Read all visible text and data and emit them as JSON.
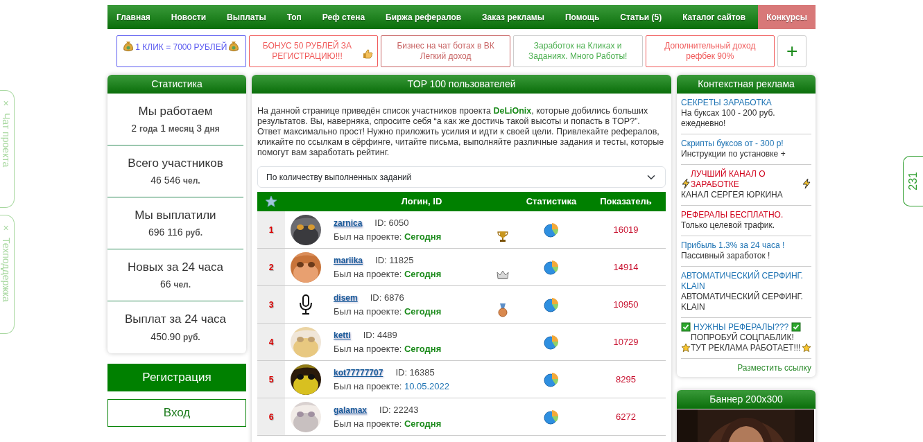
{
  "side_tabs": [
    {
      "close": "×",
      "label": "Чат проекта"
    },
    {
      "close": "×",
      "label": "Техподдержка"
    }
  ],
  "counter_tab": "231",
  "nav": [
    {
      "label": "Главная",
      "selected": false
    },
    {
      "label": "Новости",
      "selected": false
    },
    {
      "label": "Выплаты",
      "selected": false
    },
    {
      "label": "Топ",
      "selected": false
    },
    {
      "label": "Реф стена",
      "selected": false
    },
    {
      "label": "Биржа рефералов",
      "selected": false
    },
    {
      "label": "Заказ рекламы",
      "selected": false
    },
    {
      "label": "Помощь",
      "selected": false
    },
    {
      "label": "Статьи (5)",
      "selected": false
    },
    {
      "label": "Каталог сайтов",
      "selected": false
    },
    {
      "label": "Конкурсы",
      "selected": true
    }
  ],
  "ads": [
    {
      "text": "1 КЛИК = 7000 РУБЛЕЙ",
      "color": "#5a5af0",
      "kind": "bags"
    },
    {
      "text": "БОНУС 50 РУБЛЕЙ ЗА РЕГИСТРАЦИЮ!!!",
      "color": "#f05a5a",
      "kind": "thumb"
    },
    {
      "text": "Бизнес на чат ботах в ВК Легкий доход",
      "color": "#c86464",
      "kind": "plain"
    },
    {
      "text": "Заработок на Кликах и Заданиях. Много Работы!",
      "color": "#4caf50",
      "kind": "soft"
    },
    {
      "text": "Дополнительный доход рефбек 90%",
      "color": "#f05a5a",
      "kind": "plain"
    }
  ],
  "add_button": "+",
  "stats": {
    "title": "Статистика",
    "items": [
      {
        "label": "Мы работаем",
        "value": "2 **года** 1 **месяц** 3 **дня**"
      },
      {
        "label": "Всего участников",
        "value": "46 546 **чел.**"
      },
      {
        "label": "Мы выплатили",
        "value": "696 116 **руб.**"
      },
      {
        "label": "Новых за 24 часа",
        "value": "66 **чел.**"
      },
      {
        "label": "Выплат за 24 часа",
        "value": "450.90 **руб.**"
      }
    ]
  },
  "register_button": "Регистрация",
  "login_button": "Вход",
  "top": {
    "title": "TOP 100 пользователей",
    "intro": "На данной странице приведён список участников проекта **DeLiOnix**, которые добились больших результатов. Вы, наверняка, спросите себя “а как же достичь такой высоты и попасть в TOP?”. Ответ максимально прост! Нужно приложить усилия и идти к своей цели. Привлекайте рефералов, кликайте по ссылкам в сёрфинге, читайте письма, выполняйте различные задания и тесты, которые помогут вам заработать рейтинг.",
    "sort": "По количеству выполненных заданий",
    "columns": [
      "Логин, ID",
      "Статистика",
      "Показатель"
    ],
    "rows": [
      {
        "rank": "1",
        "login": "zarnica",
        "id": "ID: 6050",
        "seen_label": "Был на проекте:",
        "seen": {
          "text": "Сегодня",
          "kind": "today"
        },
        "kind": "trophy",
        "score": "16019"
      },
      {
        "rank": "2",
        "login": "mariika",
        "id": "ID: 11825",
        "seen_label": "Был на проекте:",
        "seen": {
          "text": "Сегодня",
          "kind": "today"
        },
        "kind": "crown",
        "score": "14914"
      },
      {
        "rank": "3",
        "avatar": {
          "kind": "icon"
        },
        "login": "disem",
        "id": "ID: 6876",
        "seen_label": "Был на проекте:",
        "seen": {
          "text": "Сегодня",
          "kind": "today"
        },
        "kind": "medal",
        "score": "10950"
      },
      {
        "rank": "4",
        "login": "ketti",
        "id": "ID: 4489",
        "seen_label": "Был на проекте:",
        "seen": {
          "text": "Сегодня",
          "kind": "today"
        },
        "kind": "none",
        "score": "10729"
      },
      {
        "rank": "5",
        "login": "kot77777707",
        "id": "ID: 16385",
        "seen_label": "Был на проекте:",
        "seen": {
          "text": "10.05.2022",
          "kind": "date"
        },
        "kind": "none",
        "score": "8295"
      },
      {
        "rank": "6",
        "login": "galamax",
        "id": "ID: 22243",
        "seen_label": "Был на проекте:",
        "seen": {
          "text": "Сегодня",
          "kind": "today"
        },
        "kind": "none",
        "score": "6272"
      }
    ]
  },
  "context_ads": {
    "title": "Контекстная реклама",
    "items": [
      {
        "title": "СЕКРЕТЫ ЗАРАБОТКА",
        "color": "#1f74b4",
        "text": "На буксах 100 - 200 руб. ежедневно!",
        "kind": "plain"
      },
      {
        "title": "Скрипты буксов от - 300 р!",
        "color": "#1f74b4",
        "text": "Инструкции по установке +",
        "kind": "plain"
      },
      {
        "title": "ЛУЧШИЙ КАНАЛ О ЗАРАБОТКЕ",
        "color": "#d0021b",
        "text": "КАНАЛ СЕРГЕЯ ЮРКИНА",
        "kind": "bolt"
      },
      {
        "title": "РЕФЕРАЛЫ БЕСПЛАТНО.",
        "color": "#d0021b",
        "text": "Только целевой трафик.",
        "kind": "plain"
      },
      {
        "title": "Прибыль 1.3% за 24 часа !",
        "color": "#1f74b4",
        "text": "Пассивный заработок !",
        "kind": "plain"
      },
      {
        "title": "АВТОМАТИЧЕСКИЙ СЕРФИНГ. KLAIN",
        "color": "#1f74b4",
        "text": "АВТОМАТИЧЕСКИЙ СЕРФИНГ. KLAIN",
        "kind": "plain"
      },
      {
        "title": "НУЖНЫ РЕФЕРАЛЫ???",
        "color": "#1f74b4",
        "text": "ПОПРОБУЙ СОЦПАБЛИК! ТУТ РЕКЛАМА РАБОТАЕТ!!!",
        "kind": "check-star"
      }
    ],
    "place_link": "Разместить ссылку"
  },
  "banner": {
    "title": "Баннер 200x300",
    "kind": "picture"
  }
}
